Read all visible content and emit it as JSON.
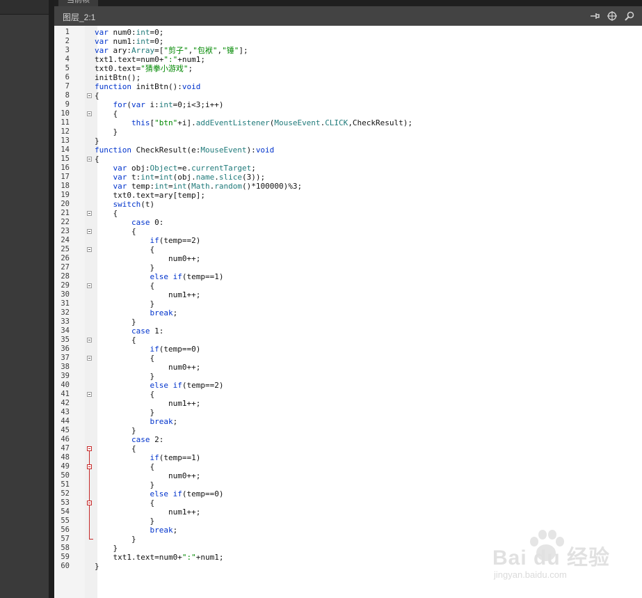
{
  "tab": {
    "label": "当前帧"
  },
  "header": {
    "title": "图层_2:1"
  },
  "icons": {
    "pin": "pin-icon",
    "target": "crosshair-icon",
    "search": "search-icon"
  },
  "code_lines": [
    {
      "n": "1",
      "fold": "",
      "html": "<span class='kw'>var</span> num0:<span class='typ'>int</span>=0;"
    },
    {
      "n": "2",
      "fold": "",
      "html": "<span class='kw'>var</span> num1:<span class='typ'>int</span>=0;"
    },
    {
      "n": "3",
      "fold": "",
      "html": "<span class='kw'>var</span> ary:<span class='typ'>Array</span>=[<span class='str'>\"剪子\"</span>,<span class='str'>\"包袱\"</span>,<span class='str'>\"锤\"</span>];"
    },
    {
      "n": "4",
      "fold": "",
      "html": "txt1.text=num0+<span class='str'>\":\"</span>+num1;"
    },
    {
      "n": "5",
      "fold": "",
      "html": "txt0.text=<span class='str'>\"猜拳小游戏\"</span>;"
    },
    {
      "n": "6",
      "fold": "",
      "html": "initBtn();"
    },
    {
      "n": "7",
      "fold": "",
      "html": "<span class='kw'>function</span> initBtn():<span class='kw'>void</span>"
    },
    {
      "n": "8",
      "fold": "g",
      "html": "{"
    },
    {
      "n": "9",
      "fold": "",
      "html": "    <span class='kw'>for</span>(<span class='kw'>var</span> i:<span class='typ'>int</span>=0;i&lt;3;i++)"
    },
    {
      "n": "10",
      "fold": "g",
      "html": "    {"
    },
    {
      "n": "11",
      "fold": "",
      "html": "        <span class='kw'>this</span>[<span class='str'>\"btn\"</span>+i].<span class='typ'>addEventListener</span>(<span class='typ'>MouseEvent</span>.<span class='typ'>CLICK</span>,CheckResult);"
    },
    {
      "n": "12",
      "fold": "",
      "html": "    }"
    },
    {
      "n": "13",
      "fold": "",
      "html": "}"
    },
    {
      "n": "14",
      "fold": "",
      "html": "<span class='kw'>function</span> CheckResult(e:<span class='typ'>MouseEvent</span>):<span class='kw'>void</span>"
    },
    {
      "n": "15",
      "fold": "g",
      "html": "{"
    },
    {
      "n": "16",
      "fold": "",
      "html": "    <span class='kw'>var</span> obj:<span class='typ'>Object</span>=e.<span class='typ'>currentTarget</span>;"
    },
    {
      "n": "17",
      "fold": "",
      "html": "    <span class='kw'>var</span> t:<span class='typ'>int</span>=<span class='typ'>int</span>(obj.<span class='typ'>name</span>.<span class='typ'>slice</span>(3));"
    },
    {
      "n": "18",
      "fold": "",
      "html": "    <span class='kw'>var</span> temp:<span class='typ'>int</span>=<span class='typ'>int</span>(<span class='typ'>Math</span>.<span class='typ'>random</span>()*100000)%3;"
    },
    {
      "n": "19",
      "fold": "",
      "html": "    txt0.text=ary[temp];"
    },
    {
      "n": "20",
      "fold": "",
      "html": "    <span class='kw'>switch</span>(t)"
    },
    {
      "n": "21",
      "fold": "g",
      "html": "    {"
    },
    {
      "n": "22",
      "fold": "",
      "html": "        <span class='kw'>case</span> 0:"
    },
    {
      "n": "23",
      "fold": "g",
      "html": "        {"
    },
    {
      "n": "24",
      "fold": "",
      "html": "            <span class='kw'>if</span>(temp==2)"
    },
    {
      "n": "25",
      "fold": "g",
      "html": "            {"
    },
    {
      "n": "26",
      "fold": "",
      "html": "                num0++;"
    },
    {
      "n": "27",
      "fold": "",
      "html": "            }"
    },
    {
      "n": "28",
      "fold": "",
      "html": "            <span class='kw'>else</span> <span class='kw'>if</span>(temp==1)"
    },
    {
      "n": "29",
      "fold": "g",
      "html": "            {"
    },
    {
      "n": "30",
      "fold": "",
      "html": "                num1++;"
    },
    {
      "n": "31",
      "fold": "",
      "html": "            }"
    },
    {
      "n": "32",
      "fold": "",
      "html": "            <span class='kw'>break</span>;"
    },
    {
      "n": "33",
      "fold": "",
      "html": "        }"
    },
    {
      "n": "34",
      "fold": "",
      "html": "        <span class='kw'>case</span> 1:"
    },
    {
      "n": "35",
      "fold": "g",
      "html": "        {"
    },
    {
      "n": "36",
      "fold": "",
      "html": "            <span class='kw'>if</span>(temp==0)"
    },
    {
      "n": "37",
      "fold": "g",
      "html": "            {"
    },
    {
      "n": "38",
      "fold": "",
      "html": "                num0++;"
    },
    {
      "n": "39",
      "fold": "",
      "html": "            }"
    },
    {
      "n": "40",
      "fold": "",
      "html": "            <span class='kw'>else</span> <span class='kw'>if</span>(temp==2)"
    },
    {
      "n": "41",
      "fold": "g",
      "html": "            {"
    },
    {
      "n": "42",
      "fold": "",
      "html": "                num1++;"
    },
    {
      "n": "43",
      "fold": "",
      "html": "            }"
    },
    {
      "n": "44",
      "fold": "",
      "html": "            <span class='kw'>break</span>;"
    },
    {
      "n": "45",
      "fold": "",
      "html": "        }"
    },
    {
      "n": "46",
      "fold": "",
      "html": "        <span class='kw'>case</span> 2:"
    },
    {
      "n": "47",
      "fold": "r",
      "html": "        {"
    },
    {
      "n": "48",
      "fold": "",
      "html": "            <span class='kw'>if</span>(temp==1)"
    },
    {
      "n": "49",
      "fold": "r",
      "html": "            {"
    },
    {
      "n": "50",
      "fold": "",
      "html": "                num0++;"
    },
    {
      "n": "51",
      "fold": "",
      "html": "            }"
    },
    {
      "n": "52",
      "fold": "",
      "html": "            <span class='kw'>else</span> <span class='kw'>if</span>(temp==0)"
    },
    {
      "n": "53",
      "fold": "r",
      "html": "            {"
    },
    {
      "n": "54",
      "fold": "",
      "html": "                num1++;"
    },
    {
      "n": "55",
      "fold": "",
      "html": "            }"
    },
    {
      "n": "56",
      "fold": "",
      "html": "            <span class='kw'>break</span>;"
    },
    {
      "n": "57",
      "fold": "",
      "html": "        }"
    },
    {
      "n": "58",
      "fold": "",
      "html": "    }"
    },
    {
      "n": "59",
      "fold": "",
      "html": "    txt1.text=num0+<span class='str'>\":\"</span>+num1;"
    },
    {
      "n": "60",
      "fold": "",
      "html": "}"
    }
  ],
  "watermark": {
    "brand": "Bai du 经验",
    "url": "jingyan.baidu.com"
  }
}
